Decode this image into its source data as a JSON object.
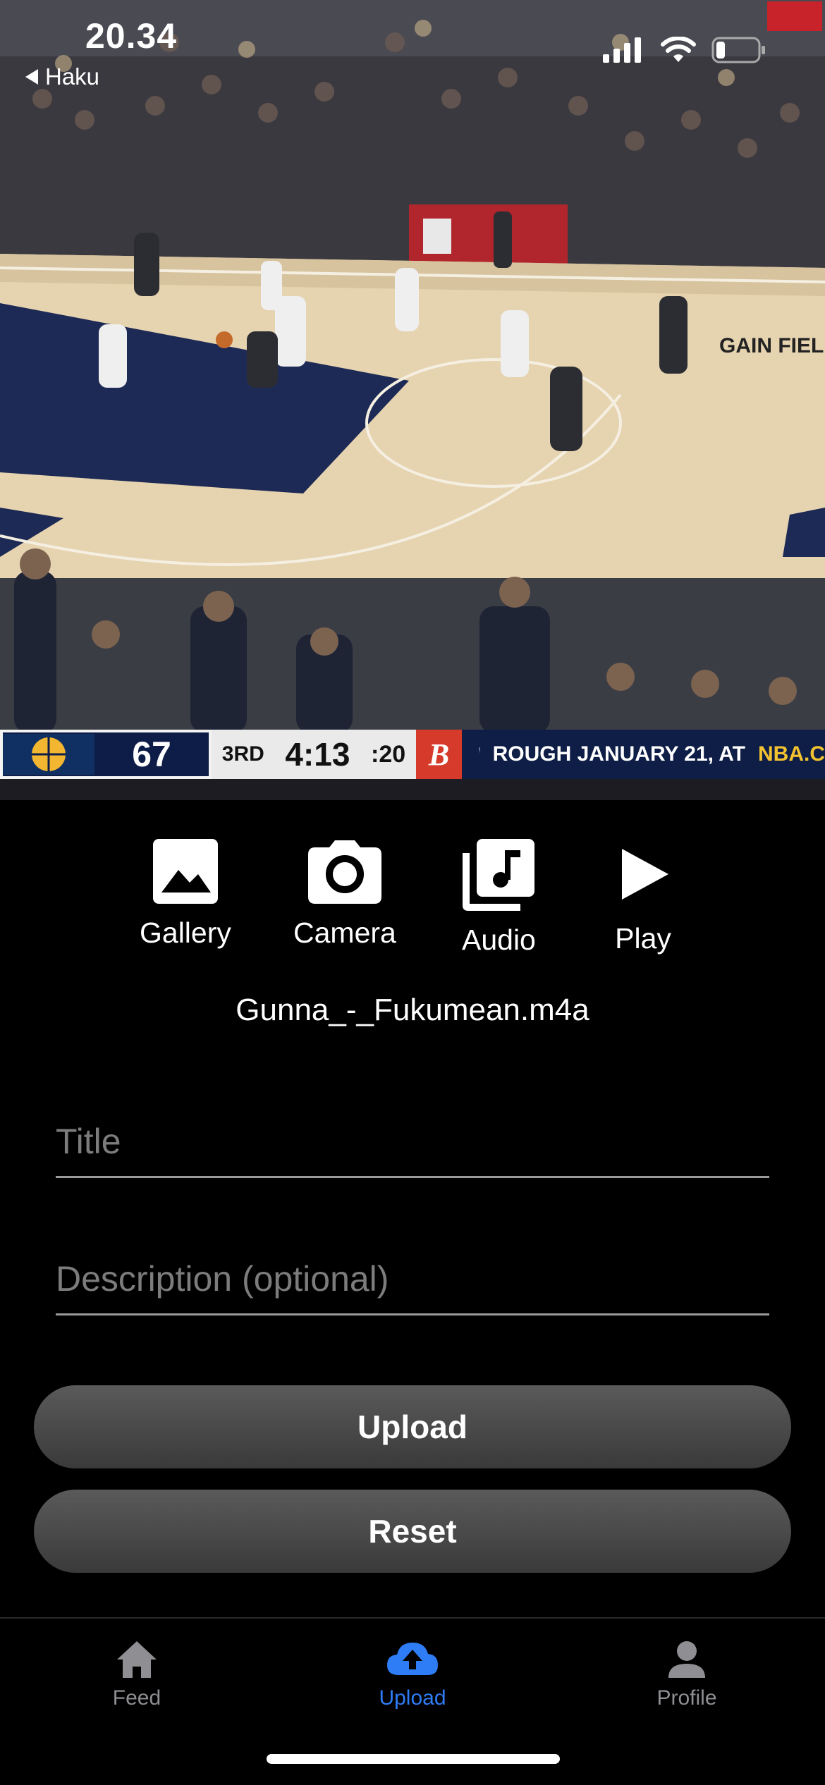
{
  "status_bar": {
    "time": "20.34",
    "back_label": "Haku"
  },
  "video": {
    "scoreboard": {
      "team_score": "67",
      "period": "3RD",
      "clock": "4:13",
      "shot_clock": ":20",
      "sponsor_letter": "B",
      "ticker": "ROUGH JANUARY 21, AT",
      "ticker_brand": "NBA.C",
      "colors": {
        "team_bg": "#0d1d47",
        "sponsor_bg": "#d53a2a",
        "clock_bg": "#eaeaea"
      }
    },
    "arena_sign": "GAIN FIELD"
  },
  "picker": {
    "gallery_label": "Gallery",
    "camera_label": "Camera",
    "audio_label": "Audio",
    "play_label": "Play",
    "icons": [
      "image-icon",
      "camera-icon",
      "music-library-icon",
      "play-icon"
    ]
  },
  "selected_file": "Gunna_-_Fukumean.m4a",
  "form": {
    "title_placeholder": "Title",
    "title_value": "",
    "description_placeholder": "Description (optional)",
    "description_value": ""
  },
  "buttons": {
    "upload_label": "Upload",
    "reset_label": "Reset"
  },
  "tabbar": {
    "feed_label": "Feed",
    "upload_label": "Upload",
    "profile_label": "Profile",
    "active_tab": "upload",
    "colors": {
      "active": "#2f7df6",
      "inactive": "#8e8e93"
    }
  }
}
